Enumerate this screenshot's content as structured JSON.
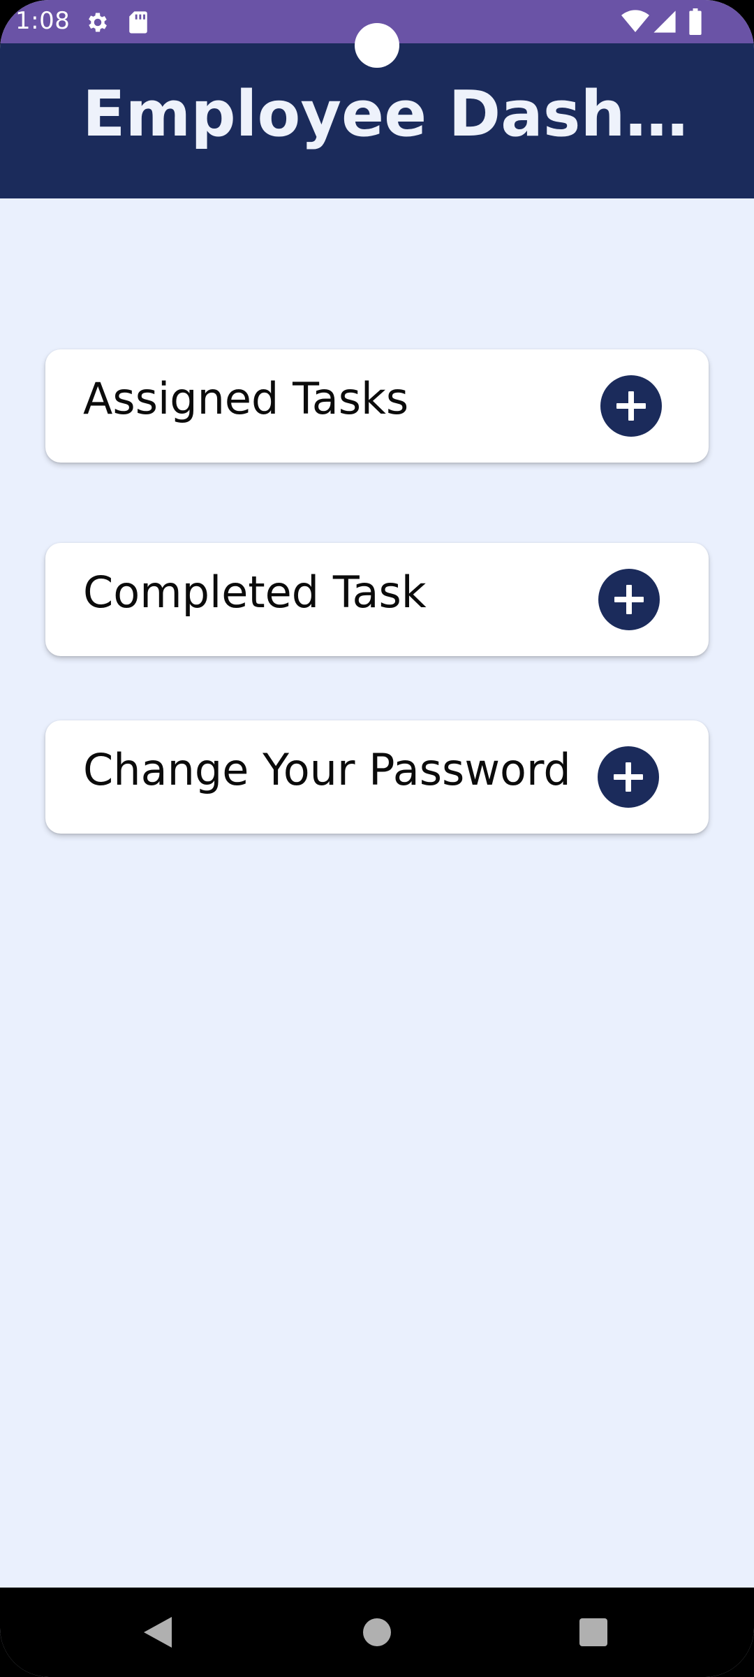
{
  "status_bar": {
    "time": "1:08",
    "icons": [
      "gear-icon",
      "sd-card-icon",
      "wifi-icon",
      "signal-icon",
      "battery-icon"
    ]
  },
  "app_bar": {
    "title": "Employee Dashboard"
  },
  "cards": [
    {
      "label": "Assigned Tasks",
      "icon": "plus-icon"
    },
    {
      "label": "Completed Task",
      "icon": "plus-icon"
    },
    {
      "label": "Change Your Password",
      "icon": "plus-icon"
    }
  ],
  "nav_bar": {
    "icons": [
      "back-icon",
      "home-icon",
      "recents-icon"
    ]
  },
  "colors": {
    "status_bar": "#6a53a6",
    "app_bar": "#1b2b5b",
    "background": "#eaf0fd",
    "card": "#ffffff",
    "accent": "#1b2b5b"
  }
}
